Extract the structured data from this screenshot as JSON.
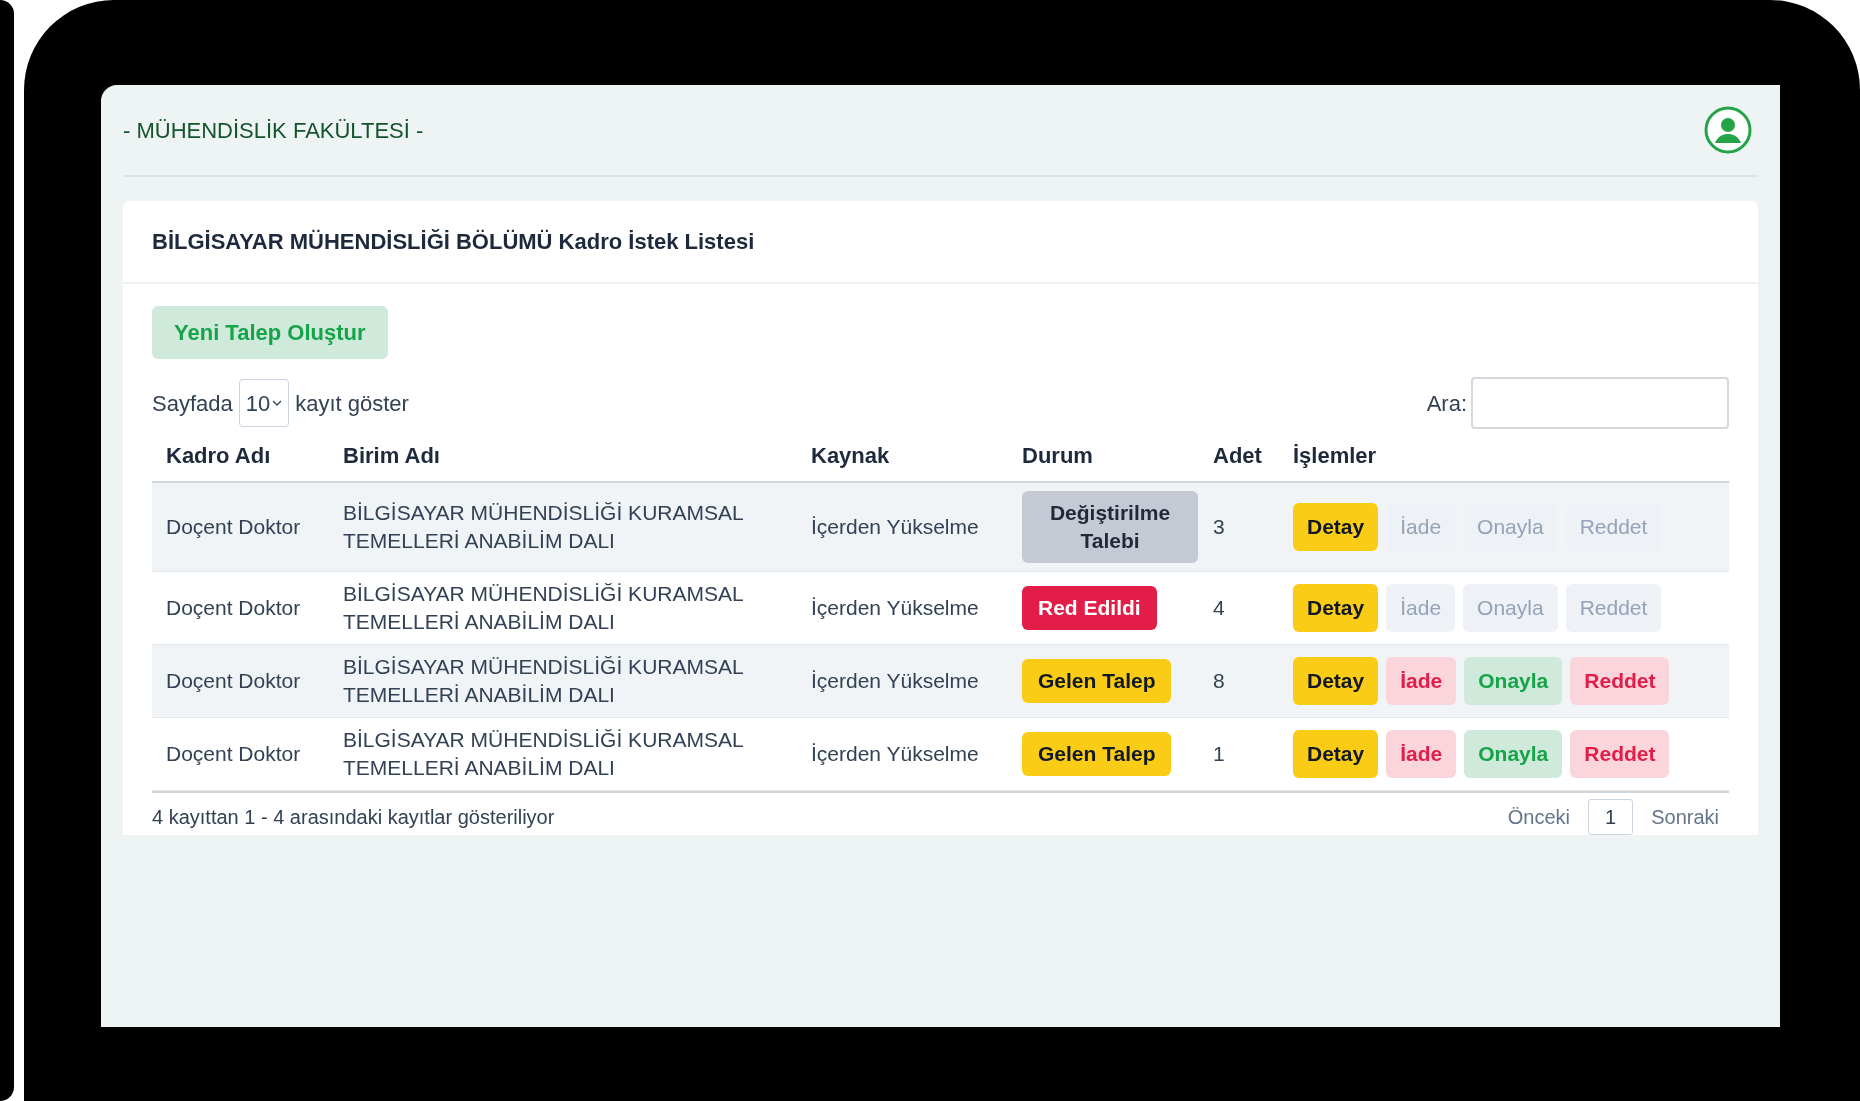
{
  "header": {
    "faculty": "- MÜHENDİSLİK FAKÜLTESİ -"
  },
  "card": {
    "title": "BİLGİSAYAR MÜHENDİSLİĞİ BÖLÜMÜ Kadro İstek Listesi",
    "new_button": "Yeni Talep Oluştur",
    "length": {
      "before": "Sayfada",
      "value": "10",
      "after": "kayıt göster"
    },
    "search": {
      "label": "Ara:"
    },
    "table": {
      "columns": [
        "Kadro Adı",
        "Birim Adı",
        "Kaynak",
        "Durum",
        "Adet",
        "İşlemler"
      ],
      "rows": [
        {
          "kadro": "Doçent Doktor",
          "birim": "BİLGİSAYAR MÜHENDİSLİĞİ KURAMSAL TEMELLERİ ANABİLİM DALI",
          "kaynak": "İçerden Yükselme",
          "status": {
            "label": "Değiştirilme Talebi",
            "kind": "change"
          },
          "adet": "3",
          "actions": [
            {
              "label": "Detay",
              "kind": "detail",
              "disabled": false
            },
            {
              "label": "İade",
              "kind": "return",
              "disabled": true
            },
            {
              "label": "Onayla",
              "kind": "approve",
              "disabled": true
            },
            {
              "label": "Reddet",
              "kind": "reject",
              "disabled": true
            }
          ]
        },
        {
          "kadro": "Doçent Doktor",
          "birim": "BİLGİSAYAR MÜHENDİSLİĞİ KURAMSAL TEMELLERİ ANABİLİM DALI",
          "kaynak": "İçerden Yükselme",
          "status": {
            "label": "Red Edildi",
            "kind": "rejected"
          },
          "adet": "4",
          "actions": [
            {
              "label": "Detay",
              "kind": "detail",
              "disabled": false
            },
            {
              "label": "İade",
              "kind": "return",
              "disabled": true
            },
            {
              "label": "Onayla",
              "kind": "approve",
              "disabled": true
            },
            {
              "label": "Reddet",
              "kind": "reject",
              "disabled": true
            }
          ]
        },
        {
          "kadro": "Doçent Doktor",
          "birim": "BİLGİSAYAR MÜHENDİSLİĞİ KURAMSAL TEMELLERİ ANABİLİM DALI",
          "kaynak": "İçerden Yükselme",
          "status": {
            "label": "Gelen Talep",
            "kind": "incoming"
          },
          "adet": "8",
          "actions": [
            {
              "label": "Detay",
              "kind": "detail",
              "disabled": false
            },
            {
              "label": "İade",
              "kind": "return",
              "disabled": false
            },
            {
              "label": "Onayla",
              "kind": "approve",
              "disabled": false
            },
            {
              "label": "Reddet",
              "kind": "reject",
              "disabled": false
            }
          ]
        },
        {
          "kadro": "Doçent Doktor",
          "birim": "BİLGİSAYAR MÜHENDİSLİĞİ KURAMSAL TEMELLERİ ANABİLİM DALI",
          "kaynak": "İçerden Yükselme",
          "status": {
            "label": "Gelen Talep",
            "kind": "incoming"
          },
          "adet": "1",
          "actions": [
            {
              "label": "Detay",
              "kind": "detail",
              "disabled": false
            },
            {
              "label": "İade",
              "kind": "return",
              "disabled": false
            },
            {
              "label": "Onayla",
              "kind": "approve",
              "disabled": false
            },
            {
              "label": "Reddet",
              "kind": "reject",
              "disabled": false
            }
          ]
        }
      ]
    },
    "footer": {
      "info": "4 kayıttan 1 - 4 arasındaki kayıtlar gösteriliyor",
      "previous": "Önceki",
      "page": "1",
      "next": "Sonraki"
    }
  }
}
